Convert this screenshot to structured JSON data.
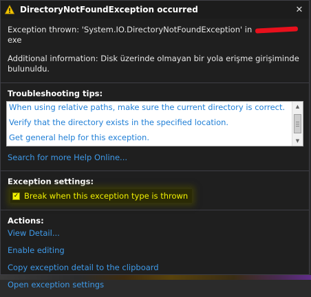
{
  "dialog": {
    "title": "DirectoryNotFoundException occurred",
    "close_glyph": "✕",
    "message_prefix": "Exception thrown: 'System.IO.DirectoryNotFoundException' in ",
    "message_suffix": "exe",
    "additional_info": "Additional information: Disk üzerinde olmayan bir yola erişme girişiminde bulunuldu."
  },
  "troubleshooting": {
    "heading": "Troubleshooting tips:",
    "tips": [
      "When using relative paths, make sure the current directory is correct.",
      "Verify that the directory exists in the specified location.",
      "Get general help for this exception."
    ],
    "search_link": "Search for more Help Online..."
  },
  "exception_settings": {
    "heading": "Exception settings:",
    "checkbox_label": "Break when this exception type is thrown",
    "checked": true,
    "check_glyph": "✓"
  },
  "actions": {
    "heading": "Actions:",
    "links": [
      "View Detail...",
      "Enable editing",
      "Copy exception detail to the clipboard",
      "Open exception settings"
    ]
  },
  "scrollbar": {
    "up_glyph": "▲",
    "down_glyph": "▼"
  },
  "colors": {
    "background": "#1f1f1f",
    "link": "#3f9ae8",
    "highlight": "#f2f200",
    "warning": "#f0c400"
  },
  "icons": {
    "title": "warning-icon",
    "close": "close-icon"
  }
}
